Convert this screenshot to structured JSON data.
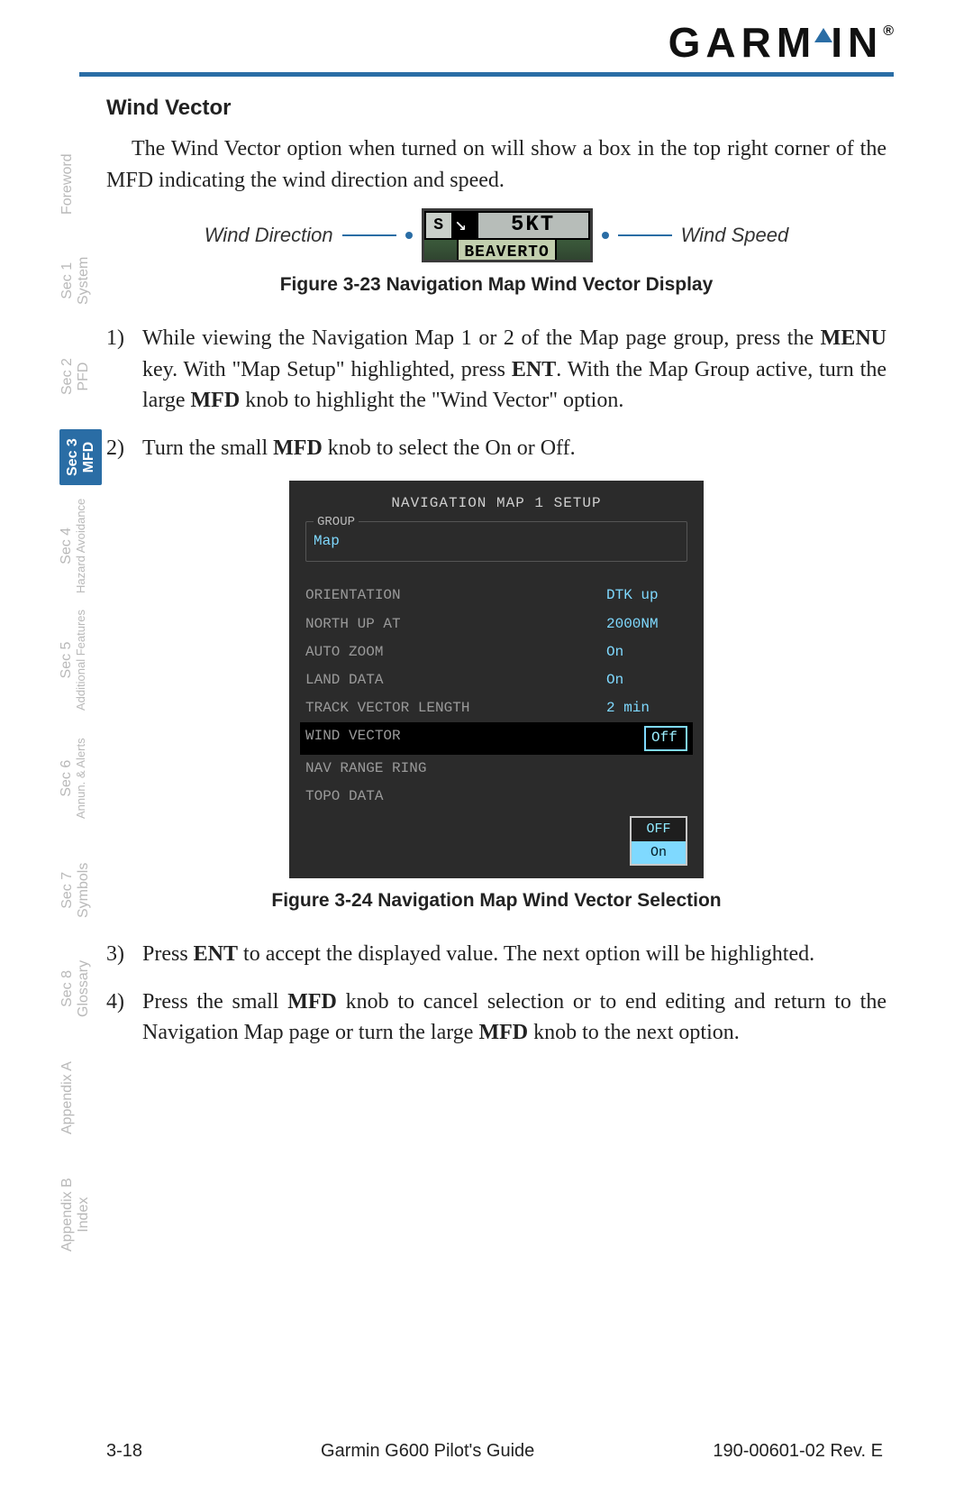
{
  "brand": "GARMIN",
  "section_title": "Wind Vector",
  "intro": "The Wind Vector option when turned on will show a box in the top right corner of the MFD indicating the wind direction and speed.",
  "fig1": {
    "left_label": "Wind Direction",
    "right_label": "Wind Speed",
    "s_box": "S",
    "kt": "5KT",
    "city": "BEAVERTO",
    "caption": "Figure 3-23  Navigation Map Wind Vector Display"
  },
  "steps": {
    "s1_num": "1)",
    "s1_a": "While viewing the Navigation Map 1 or 2 of the Map page group, press the ",
    "s1_b": "MENU",
    "s1_c": " key. With \"Map Setup\" highlighted, press ",
    "s1_d": "ENT",
    "s1_e": ". With the Map Group active, turn the large ",
    "s1_f": "MFD",
    "s1_g": " knob to highlight the \"Wind Vector\" option.",
    "s2_num": "2)",
    "s2_a": "Turn the small ",
    "s2_b": "MFD",
    "s2_c": " knob to select the On or Off.",
    "s3_num": "3)",
    "s3_a": "Press ",
    "s3_b": "ENT",
    "s3_c": " to accept the displayed value. The next option will be highlighted.",
    "s4_num": "4)",
    "s4_a": "Press the small ",
    "s4_b": "MFD",
    "s4_c": " knob to cancel selection or to end editing and return to the Navigation Map page or turn the large ",
    "s4_d": "MFD",
    "s4_e": " knob to the next option."
  },
  "setup": {
    "title": "NAVIGATION MAP 1 SETUP",
    "group_label": "GROUP",
    "group_value": "Map",
    "rows": [
      {
        "k": "ORIENTATION",
        "v": "DTK up"
      },
      {
        "k": "NORTH UP AT",
        "v": "2000NM"
      },
      {
        "k": "AUTO ZOOM",
        "v": "On"
      },
      {
        "k": "LAND DATA",
        "v": "On"
      },
      {
        "k": "TRACK VECTOR LENGTH",
        "v": "2 min"
      },
      {
        "k": "WIND VECTOR",
        "v": "Off"
      },
      {
        "k": "NAV RANGE RING",
        "v": ""
      },
      {
        "k": "TOPO DATA",
        "v": ""
      }
    ],
    "popup_off": "OFF",
    "popup_on": "On",
    "caption": "Figure 3-24  Navigation Map Wind Vector Selection"
  },
  "tabs": [
    {
      "l1": "Foreword",
      "l2": ""
    },
    {
      "l1": "Sec 1",
      "l2": "System"
    },
    {
      "l1": "Sec 2",
      "l2": "PFD"
    },
    {
      "l1": "Sec 3",
      "l2": "MFD"
    },
    {
      "l1": "Sec 4",
      "l2": "Hazard Avoidance"
    },
    {
      "l1": "Sec 5",
      "l2": "Additional Features"
    },
    {
      "l1": "Sec 6",
      "l2": "Annun. & Alerts"
    },
    {
      "l1": "Sec 7",
      "l2": "Symbols"
    },
    {
      "l1": "Sec 8",
      "l2": "Glossary"
    },
    {
      "l1": "Appendix A",
      "l2": ""
    },
    {
      "l1": "Appendix B",
      "l2": "Index"
    }
  ],
  "footer": {
    "page": "3-18",
    "title": "Garmin G600 Pilot's Guide",
    "rev": "190-00601-02  Rev. E"
  }
}
